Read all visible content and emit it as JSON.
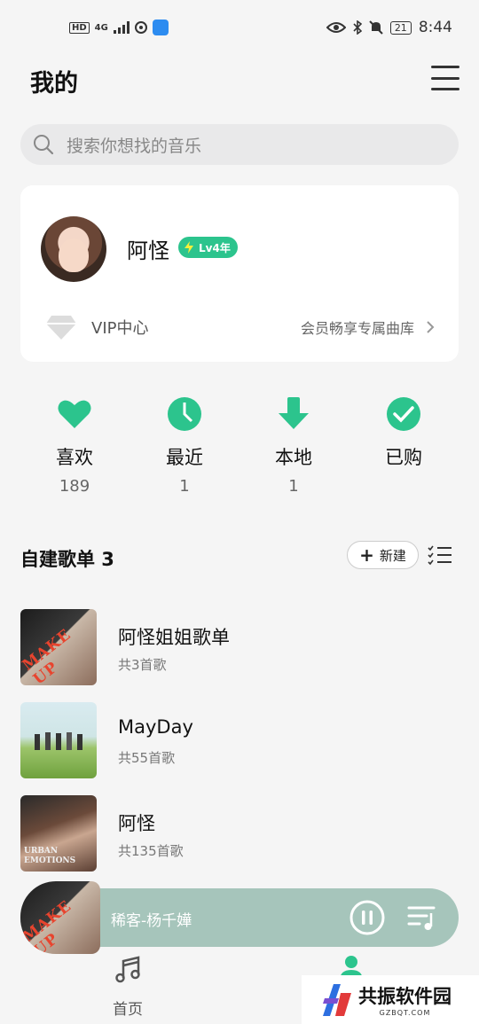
{
  "status_bar": {
    "hd": "HD",
    "network": "4G",
    "battery": "21",
    "time": "8:44"
  },
  "header": {
    "title": "我的"
  },
  "search": {
    "placeholder": "搜索你想找的音乐"
  },
  "profile": {
    "name": "阿怪",
    "level_badge": "Lv4年",
    "vip_label": "VIP中心",
    "vip_promo": "会员畅享专属曲库"
  },
  "quick_actions": [
    {
      "label": "喜欢",
      "count": "189",
      "icon": "heart-icon"
    },
    {
      "label": "最近",
      "count": "1",
      "icon": "clock-icon"
    },
    {
      "label": "本地",
      "count": "1",
      "icon": "download-icon"
    },
    {
      "label": "已购",
      "count": "",
      "icon": "check-icon"
    }
  ],
  "playlists": {
    "header": "自建歌单 3",
    "new_label": "新建",
    "items": [
      {
        "name": "阿怪姐姐歌单",
        "count": "共3首歌",
        "cover_text": "MAKE UP"
      },
      {
        "name": "MayDay",
        "count": "共55首歌",
        "cover_text": ""
      },
      {
        "name": "阿怪",
        "count": "共135首歌",
        "cover_text": "URBAN EMOTIONS"
      }
    ]
  },
  "player": {
    "title": "稀客-杨千嬅",
    "cover_text": "MAKE UP"
  },
  "nav": {
    "home_label": "首页"
  },
  "watermark": {
    "title": "共振软件园",
    "sub": "GZBQT.COM"
  },
  "colors": {
    "accent": "#2cc48d",
    "player_bg": "#a6c5bb"
  }
}
